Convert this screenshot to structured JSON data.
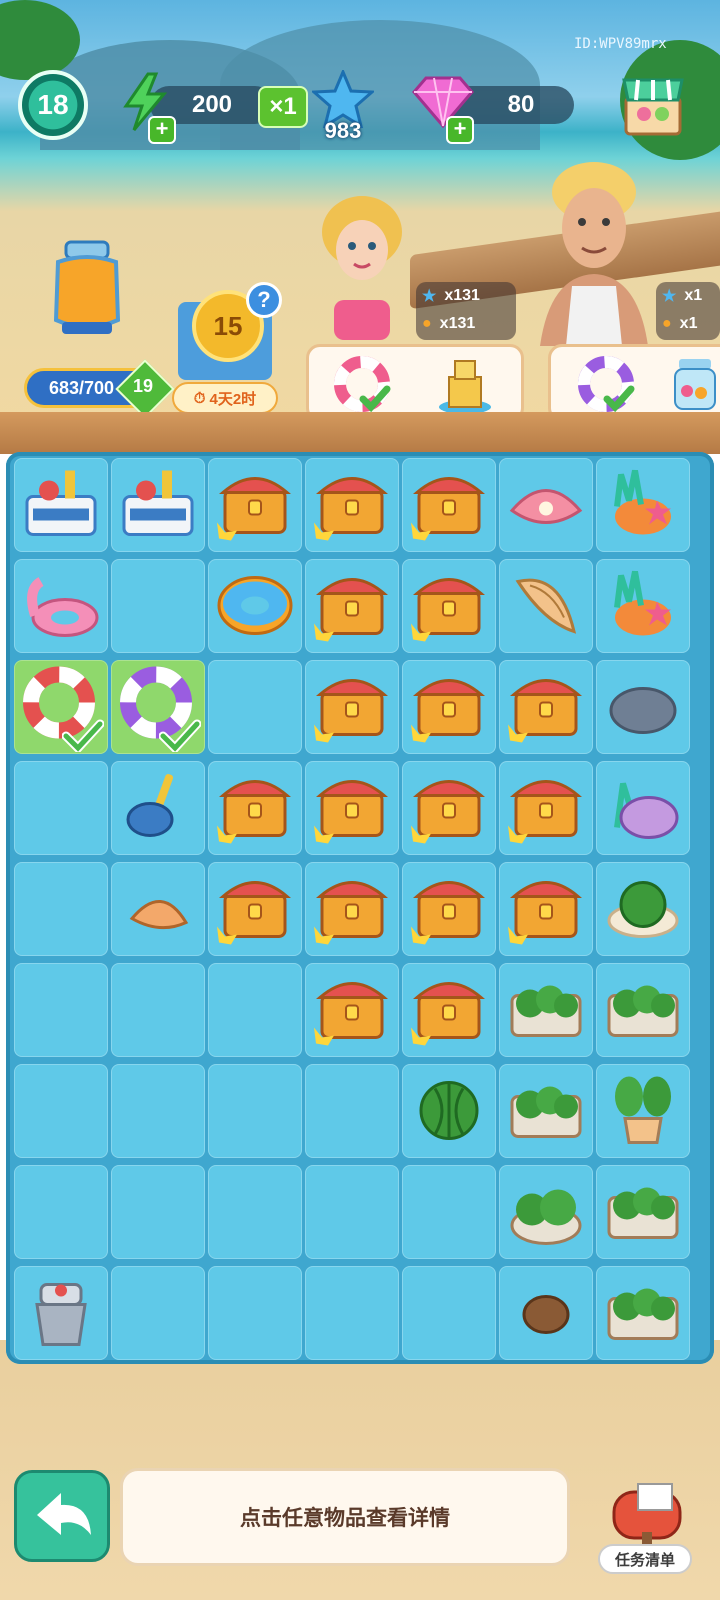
{
  "hud": {
    "level": "18",
    "energy": "200",
    "energy_multiplier": "×1",
    "stars": "983",
    "gems": "80",
    "player_id": "ID:WPV89mrx"
  },
  "jar": {
    "progress_text": "683/700",
    "progress_fraction": 0.976,
    "badge": "19"
  },
  "event": {
    "coin_value": "15",
    "help": "?",
    "timer": "4天2时"
  },
  "requests": [
    {
      "line1": "x131",
      "line2": "x131"
    },
    {
      "line1": "x1",
      "line2": "x1"
    }
  ],
  "board": {
    "rows": 9,
    "cols": 7,
    "cells": [
      [
        "surf-bucket",
        "surf-bucket",
        "treasure-chest",
        "treasure-chest",
        "treasure-chest",
        "pearl-shell",
        "coral-starfish"
      ],
      [
        "flamingo-float",
        "",
        "donut-float",
        "treasure-chest",
        "treasure-chest",
        "conch-shell",
        "coral-starfish"
      ],
      [
        "lifebuoy-red",
        "lifebuoy-purple",
        "",
        "treasure-chest",
        "treasure-chest",
        "treasure-chest",
        "rock"
      ],
      [
        "",
        "blue-shovel",
        "treasure-chest",
        "treasure-chest",
        "treasure-chest",
        "treasure-chest",
        "coral-shell"
      ],
      [
        "",
        "small-shell",
        "treasure-chest",
        "treasure-chest",
        "treasure-chest",
        "treasure-chest",
        "melon-plate"
      ],
      [
        "",
        "",
        "",
        "treasure-chest",
        "treasure-chest",
        "melon-crate",
        "melon-crate"
      ],
      [
        "",
        "",
        "",
        "",
        "watermelon",
        "melon-crate",
        "potted-plant"
      ],
      [
        "",
        "",
        "",
        "",
        "",
        "melon-bowl",
        "melon-crate"
      ],
      [
        "juicer",
        "",
        "",
        "",
        "",
        "seed",
        "melon-crate"
      ]
    ],
    "completed_cells": [
      [
        2,
        0
      ],
      [
        2,
        1
      ]
    ]
  },
  "footer": {
    "hint": "点击任意物品查看详情",
    "task_list": "任务清单"
  }
}
